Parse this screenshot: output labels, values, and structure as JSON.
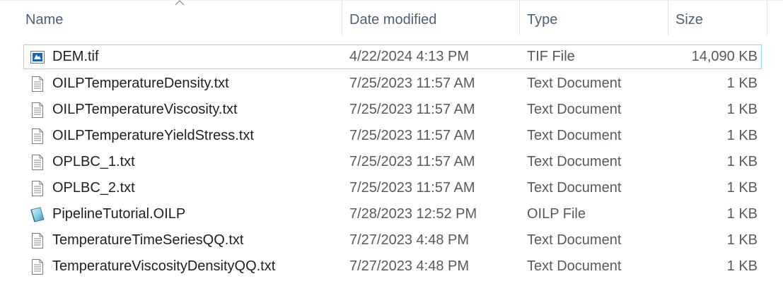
{
  "columns": {
    "name": "Name",
    "date": "Date modified",
    "type": "Type",
    "size": "Size"
  },
  "sort": {
    "column": "name",
    "direction": "ascending",
    "icon": "sort-up-icon"
  },
  "files": [
    {
      "name": "DEM.tif",
      "date": "4/22/2024 4:13 PM",
      "type": "TIF File",
      "size": "14,090 KB",
      "icon": "image-file-icon",
      "selected": true
    },
    {
      "name": "OILPTemperatureDensity.txt",
      "date": "7/25/2023 11:57 AM",
      "type": "Text Document",
      "size": "1 KB",
      "icon": "text-file-icon",
      "selected": false
    },
    {
      "name": "OILPTemperatureViscosity.txt",
      "date": "7/25/2023 11:57 AM",
      "type": "Text Document",
      "size": "1 KB",
      "icon": "text-file-icon",
      "selected": false
    },
    {
      "name": "OILPTemperatureYieldStress.txt",
      "date": "7/25/2023 11:57 AM",
      "type": "Text Document",
      "size": "1 KB",
      "icon": "text-file-icon",
      "selected": false
    },
    {
      "name": "OPLBC_1.txt",
      "date": "7/25/2023 11:57 AM",
      "type": "Text Document",
      "size": "1 KB",
      "icon": "text-file-icon",
      "selected": false
    },
    {
      "name": "OPLBC_2.txt",
      "date": "7/25/2023 11:57 AM",
      "type": "Text Document",
      "size": "1 KB",
      "icon": "text-file-icon",
      "selected": false
    },
    {
      "name": "PipelineTutorial.OILP",
      "date": "7/28/2023 12:52 PM",
      "type": "OILP File",
      "size": "1 KB",
      "icon": "oilp-file-icon",
      "selected": false
    },
    {
      "name": "TemperatureTimeSeriesQQ.txt",
      "date": "7/27/2023 4:48 PM",
      "type": "Text Document",
      "size": "1 KB",
      "icon": "text-file-icon",
      "selected": false
    },
    {
      "name": "TemperatureViscosityDensityQQ.txt",
      "date": "7/27/2023 4:48 PM",
      "type": "Text Document",
      "size": "1 KB",
      "icon": "text-file-icon",
      "selected": false
    }
  ],
  "colors": {
    "header_text": "#4c607a",
    "selection_border": "#99d1ff",
    "secondary_text": "#555a60"
  }
}
